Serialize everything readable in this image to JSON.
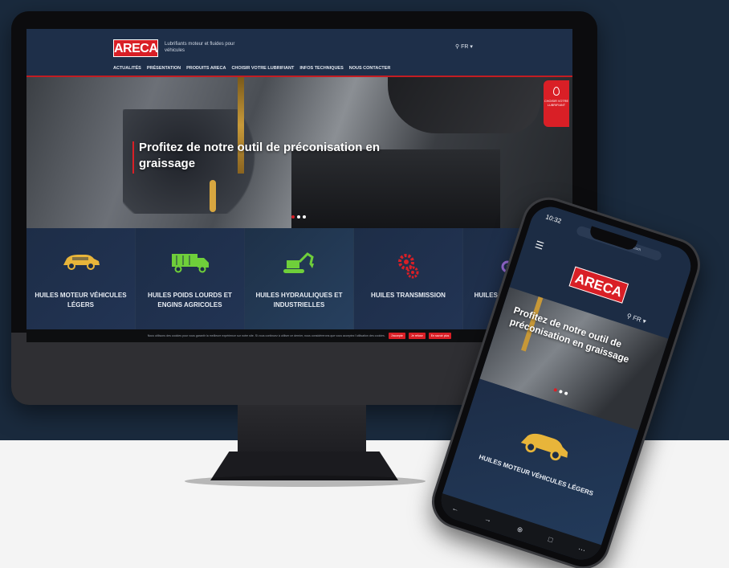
{
  "desktop": {
    "logo": "ARECA",
    "tagline": "Lubrifiants moteur et fluides pour véhicules",
    "lang": "FR",
    "nav": [
      "ACTUALITÉS",
      "PRÉSENTATION",
      "PRODUITS ARECA",
      "CHOISIR VOTRE LUBRIFIANT",
      "INFOS TECHNIQUES",
      "NOUS CONTACTER"
    ],
    "hero_title": "Profitez de notre outil de préconisation en graissage",
    "side_badge": "CHOISIR VOTRE LUBRIFIANT",
    "categories": [
      {
        "label": "HUILES MOTEUR VÉHICULES LÉGERS",
        "icon": "car-icon"
      },
      {
        "label": "HUILES POIDS LOURDS ET ENGINS AGRICOLES",
        "icon": "truck-icon"
      },
      {
        "label": "HUILES HYDRAULIQUES ET INDUSTRIELLES",
        "icon": "excavator-icon"
      },
      {
        "label": "HUILES TRANSMISSION",
        "icon": "gears-icon"
      },
      {
        "label": "HUILES 2TPS & 4TPS MOTO LOISIR",
        "icon": "motorcycle-icon"
      }
    ],
    "cookie": {
      "message": "Nous utilisons des cookies pour vous garantir la meilleure expérience sur notre site. Si vous continuez à utiliser ce dernier, nous considérerons que vous acceptez l'utilisation des cookies.",
      "buttons": [
        "J'accepte",
        "Je refuse",
        "En savoir plus"
      ]
    }
  },
  "phone": {
    "time": "10:32",
    "url": "www.arecalubrifiants.com",
    "logo": "ARECA",
    "lang": "FR",
    "hero_title": "Profitez de notre outil de préconisation en graissage",
    "category_label": "HUILES MOTEUR VÉHICULES LÉGERS"
  },
  "colors": {
    "brand_red": "#d91f26",
    "navy": "#1c2c44",
    "accent_yellow": "#e8b53a",
    "accent_green": "#6fcf3a",
    "accent_purple": "#a070e0"
  }
}
